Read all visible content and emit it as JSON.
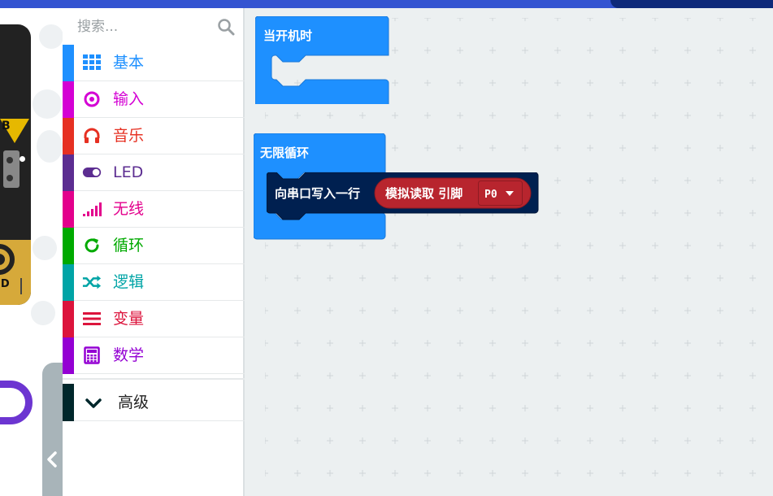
{
  "search": {
    "placeholder": "搜索..."
  },
  "simulator": {
    "button_label": "B",
    "pin_label": "ND"
  },
  "categories": [
    {
      "label": "基本",
      "color": "#1e90ff",
      "icon": "grid-icon"
    },
    {
      "label": "输入",
      "color": "#d400d4",
      "icon": "target-icon"
    },
    {
      "label": "音乐",
      "color": "#e63022",
      "icon": "headphones-icon"
    },
    {
      "label": "LED",
      "color": "#5c2d91",
      "icon": "toggle-icon"
    },
    {
      "label": "无线",
      "color": "#e3008c",
      "icon": "signal-icon"
    },
    {
      "label": "循环",
      "color": "#00aa00",
      "icon": "refresh-icon"
    },
    {
      "label": "逻辑",
      "color": "#00a4a6",
      "icon": "shuffle-icon"
    },
    {
      "label": "变量",
      "color": "#dc143c",
      "icon": "lines-icon"
    },
    {
      "label": "数学",
      "color": "#9400d3",
      "icon": "calculator-icon"
    }
  ],
  "advanced": {
    "label": "高级",
    "color": "#00272b",
    "icon": "chevron-down-icon"
  },
  "blocks": {
    "on_start": {
      "label": "当开机时",
      "color": "#1e90ff"
    },
    "forever": {
      "label": "无限循环",
      "color": "#1e90ff"
    },
    "serial_write": {
      "label": "向串口写入一行",
      "color": "#002050"
    },
    "analog_read": {
      "label": "模拟读取 引脚",
      "color": "#b8252e"
    },
    "pin_dropdown": {
      "value": "P0"
    }
  }
}
